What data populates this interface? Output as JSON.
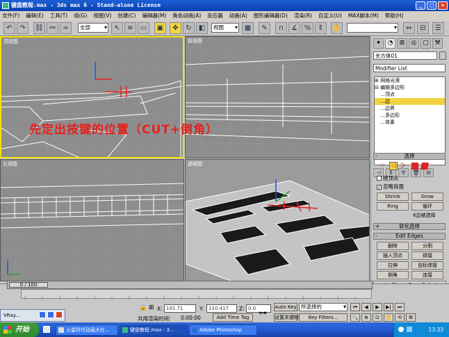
{
  "titlebar": {
    "title": "键盘教程.max - 3ds max 6 - Stand-alone License"
  },
  "menu": [
    "文件(F)",
    "编辑(E)",
    "工具(T)",
    "组(G)",
    "视图(V)",
    "创建(C)",
    "编辑器(M)",
    "角色动画(A)",
    "反应器",
    "动画(A)",
    "图形编辑器(D)",
    "渲染(R)",
    "自定义(U)",
    "MAX脚本(M)",
    "帮助(H)"
  ],
  "toolbar": {
    "selection_filter": "全部",
    "ref_coord": "视图",
    "named_sel": ""
  },
  "viewports": {
    "top_left": "顶视图",
    "top_right": "前视图",
    "bottom_left": "左视图",
    "bottom_right": "透视图"
  },
  "overlay_text": "先定出按键的位置（CUT+倒角）",
  "command_panel": {
    "object_name": "长方体01",
    "modifier_list": "Modifier List",
    "stack": [
      {
        "label": "⊞ 网格光滑",
        "selected": false
      },
      {
        "label": "⊟ 编辑多边形",
        "selected": false
      },
      {
        "label": "…顶点",
        "selected": false
      },
      {
        "label": "…边",
        "selected": true
      },
      {
        "label": "…边界",
        "selected": false
      },
      {
        "label": "…多边形",
        "selected": false
      },
      {
        "label": "…体素",
        "selected": false
      }
    ],
    "rollout_select": "选择",
    "chk_by_vertex": "按顶点",
    "chk_ignore_back": "忽略背面",
    "btn_shrink": "Shrink",
    "btn_grow": "Grow",
    "btn_ring": "Ring",
    "btn_loop": "循环",
    "sel_count": "6边被选择",
    "rollout_soft": "软化选择",
    "rollout_edit_edges": "Edit Edges",
    "btn_remove": "删除",
    "btn_split": "分割",
    "btn_insert_vertex": "插入顶点",
    "btn_weld": "焊接",
    "btn_extrude": "拉伸",
    "btn_target_weld": "目标焊接",
    "btn_chamfer": "倒角",
    "btn_connect": "连接",
    "btn_create_shape": "ate Shape From Select"
  },
  "timeline": {
    "frame": "0 / 100"
  },
  "status": {
    "x_label": "X:",
    "x_value": "191.71",
    "y_label": "Y:",
    "y_value": "110.417",
    "z_label": "Z:",
    "z_value": "0.0",
    "render_time_label": "共用渲染时间:",
    "render_time": "0:00:00",
    "add_time_tag": "Add Time Tag",
    "auto_key": "Auto Key",
    "selected_dropdown": "所选择的",
    "set_key": "设置关键帧",
    "key_filters": "Key Filters..."
  },
  "taskbar": {
    "start": "开始",
    "items": [
      "火星时代动画大社...",
      "键盘教程.max - 3...",
      "Adobe Photoshop"
    ],
    "clock": "13:33",
    "vray": "VRay..."
  },
  "colors": {
    "selection": "#f2d443",
    "overlay": "#e8201e",
    "viewport_bg": "#8d8d8d"
  }
}
